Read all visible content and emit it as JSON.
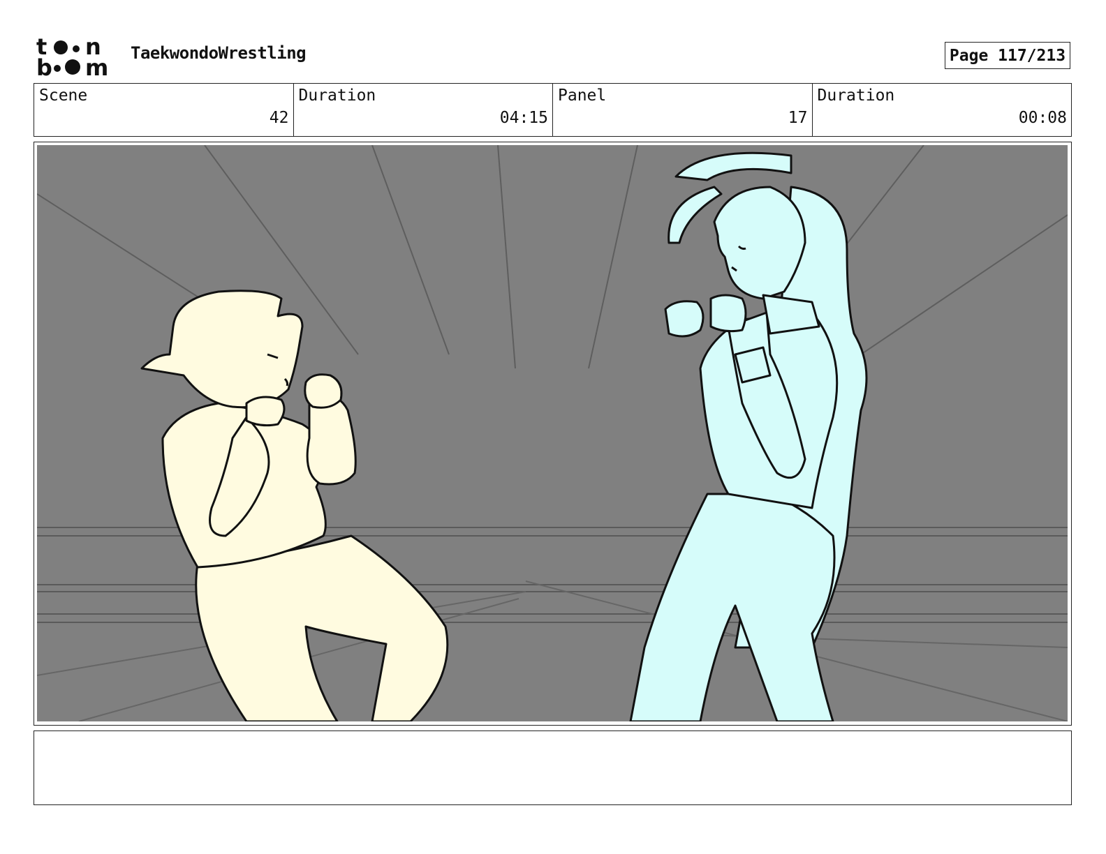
{
  "logo": {
    "line1": "toon",
    "line2": "boom"
  },
  "header": {
    "project_title": "TaekwondoWrestling",
    "page": "Page 117/213"
  },
  "info": [
    {
      "label": "Scene",
      "value": "42"
    },
    {
      "label": "Duration",
      "value": "04:15"
    },
    {
      "label": "Panel",
      "value": "17"
    },
    {
      "label": "Duration",
      "value": "00:08"
    }
  ],
  "colors": {
    "background_gray": "#808080",
    "character_left_fill": "#fffbe0",
    "character_right_fill": "#d6fcfa",
    "line_color": "#111111"
  },
  "notes": {
    "text": ""
  }
}
